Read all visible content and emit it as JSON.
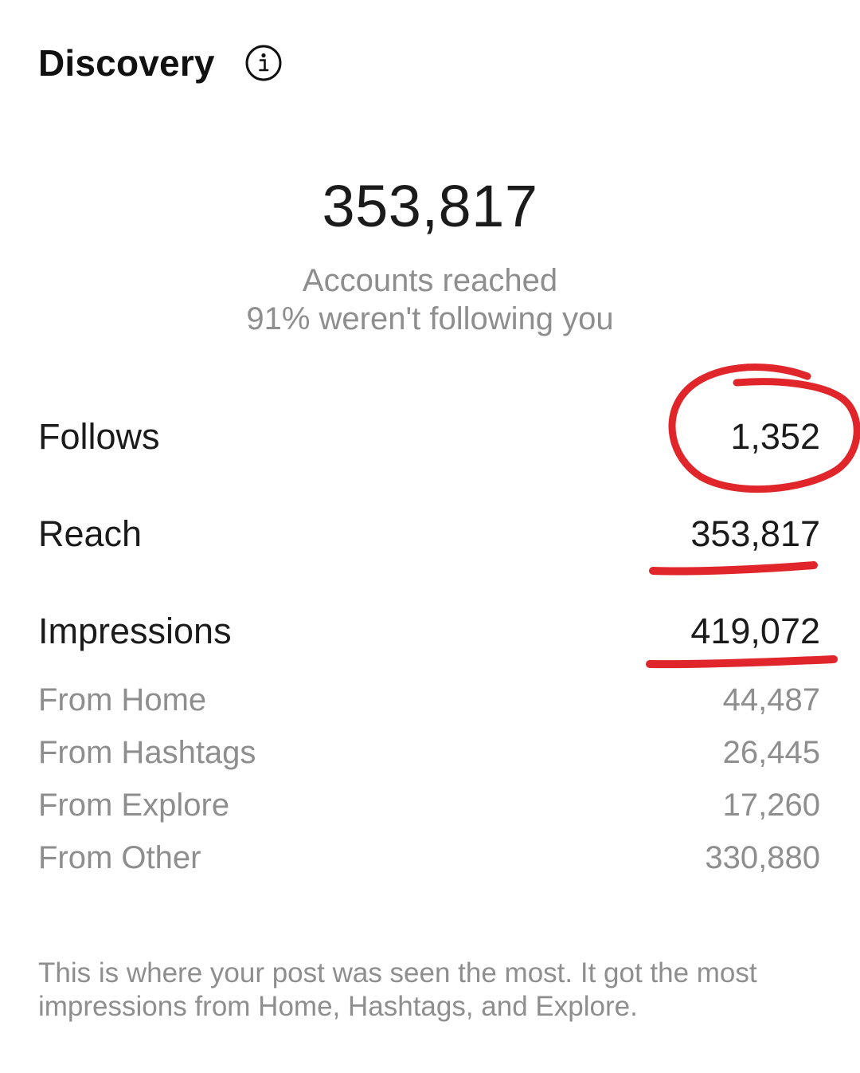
{
  "discovery": {
    "title": "Discovery",
    "info_icon": "info-icon"
  },
  "reach_summary": {
    "accounts_reached": "353,817",
    "label": "Accounts reached",
    "non_followers": "91% weren't following you"
  },
  "metrics": [
    {
      "label": "Follows",
      "value": "1,352"
    },
    {
      "label": "Reach",
      "value": "353,817"
    },
    {
      "label": "Impressions",
      "value": "419,072"
    }
  ],
  "impression_sources": [
    {
      "label": "From Home",
      "value": "44,487"
    },
    {
      "label": "From Hashtags",
      "value": "26,445"
    },
    {
      "label": "From Explore",
      "value": "17,260"
    },
    {
      "label": "From Other",
      "value": "330,880"
    }
  ],
  "footnote": "This is where your post was seen the most. It got the most impressions from Home, Hashtags, and Explore.",
  "colors": {
    "annotation": "#e0262b",
    "primary_text": "#1b1b1b",
    "secondary_text": "#8e8e8e"
  }
}
